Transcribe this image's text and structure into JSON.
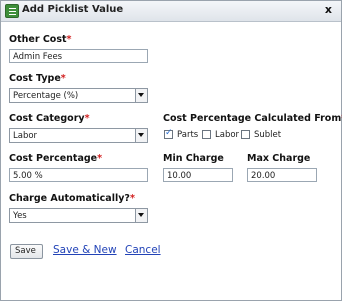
{
  "dialog": {
    "title": "Add Picklist Value",
    "close_label": "x"
  },
  "form": {
    "other_cost": {
      "label": "Other Cost",
      "required": "*",
      "value": "Admin Fees"
    },
    "cost_type": {
      "label": "Cost Type",
      "required": "*",
      "value": "Percentage (%)"
    },
    "cost_category": {
      "label": "Cost Category",
      "required": "*",
      "value": "Labor"
    },
    "calc_from": {
      "label": "Cost Percentage Calculated From",
      "required": "*",
      "options": [
        {
          "label": "Parts",
          "checked": true
        },
        {
          "label": "Labor",
          "checked": false
        },
        {
          "label": "Sublet",
          "checked": false
        }
      ]
    },
    "cost_percentage": {
      "label": "Cost Percentage",
      "required": "*",
      "value": "5.00 %"
    },
    "min_charge": {
      "label": "Min Charge",
      "value": "10.00"
    },
    "max_charge": {
      "label": "Max Charge",
      "value": "20.00"
    },
    "charge_auto": {
      "label": "Charge Automatically?",
      "required": "*",
      "value": "Yes"
    }
  },
  "actions": {
    "save": "Save",
    "save_new": "Save & New",
    "cancel": "Cancel"
  }
}
